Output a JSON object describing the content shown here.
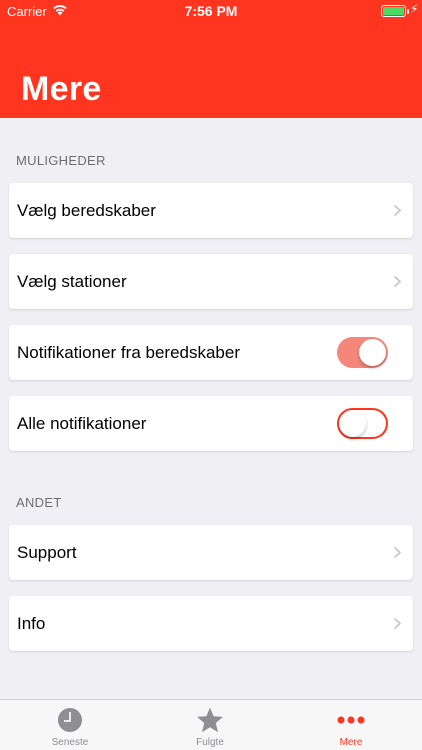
{
  "status_bar": {
    "carrier": "Carrier",
    "time": "7:56 PM",
    "battery_level": 1.0
  },
  "header": {
    "title": "Mere",
    "background_color": "#ff3520"
  },
  "sections": [
    {
      "label": "MULIGHEDER",
      "items": [
        {
          "label": "Vælg beredskaber",
          "type": "link",
          "icon": "chevron-right-icon"
        },
        {
          "label": "Vælg stationer",
          "type": "link",
          "icon": "chevron-right-icon"
        },
        {
          "label": "Notifikationer fra beredskaber",
          "type": "toggle",
          "on": true
        },
        {
          "label": "Alle notifikationer",
          "type": "toggle",
          "on": false
        }
      ]
    },
    {
      "label": "ANDET",
      "items": [
        {
          "label": "Support",
          "type": "link",
          "icon": "chevron-right-icon"
        },
        {
          "label": "Info",
          "type": "link",
          "icon": "chevron-right-icon"
        }
      ]
    }
  ],
  "tabbar": {
    "tabs": [
      {
        "label": "Seneste",
        "icon": "clock-icon",
        "active": false
      },
      {
        "label": "Fulgte",
        "icon": "star-icon",
        "active": false
      },
      {
        "label": "Mere",
        "icon": "more-dots-icon",
        "active": true
      }
    ],
    "active_color": "#ff3520",
    "inactive_color": "#8e8e93"
  }
}
